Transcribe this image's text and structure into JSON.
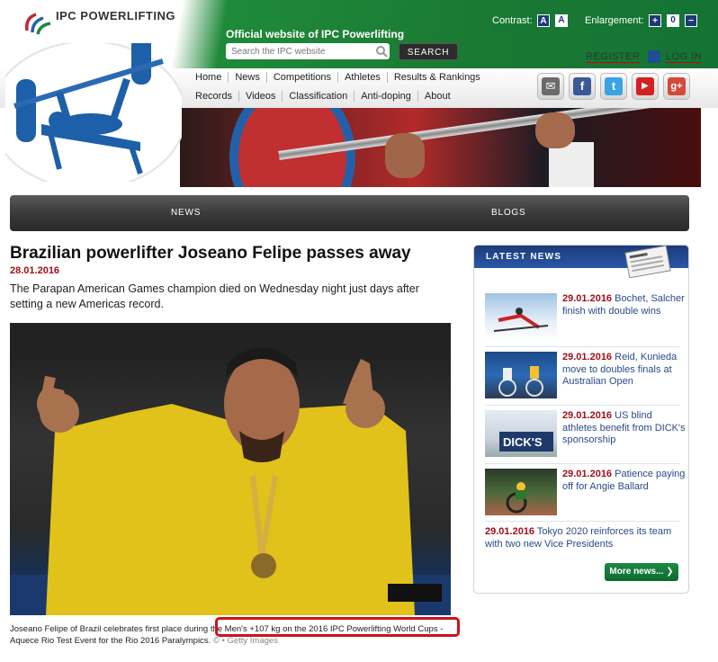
{
  "header": {
    "brand": "IPC POWERLIFTING",
    "site_title": "Official website of IPC Powerlifting",
    "search_placeholder": "Search the IPC website",
    "search_button": "SEARCH",
    "contrast_label": "Contrast:",
    "contrast_options": [
      "A",
      "A"
    ],
    "enlargement_label": "Enlargement:",
    "enlargement_controls": [
      "+",
      "0",
      "−"
    ],
    "register": "REGISTER",
    "login": "LOG IN"
  },
  "nav": {
    "row1": [
      "Home",
      "News",
      "Competitions",
      "Athletes",
      "Results & Rankings"
    ],
    "row2": [
      "Records",
      "Videos",
      "Classification",
      "Anti-doping",
      "About"
    ]
  },
  "social": [
    {
      "name": "email",
      "glyph": "✉",
      "color": "#6b6b6b"
    },
    {
      "name": "facebook",
      "glyph": "f",
      "color": "#3b5998"
    },
    {
      "name": "twitter",
      "glyph": "t",
      "color": "#3aa3e3"
    },
    {
      "name": "youtube",
      "glyph": "▶",
      "color": "#d42020"
    },
    {
      "name": "google-plus",
      "glyph": "g+",
      "color": "#d44a3a"
    }
  ],
  "tabs": [
    "NEWS",
    "BLOGS"
  ],
  "article": {
    "title": "Brazilian powerlifter Joseano Felipe passes away",
    "date": "28.01.2016",
    "lead": "The Parapan American Games champion died on Wednesday night just days after setting a new Americas record.",
    "caption": "Joseano Felipe of Brazil celebrates first place during the Men's +107 kg on the 2016 IPC Powerlifting World Cups - Aquece Rio Test Event for the Rio 2016 Paralympics.",
    "credit": "© • Getty Images"
  },
  "latest_news": {
    "heading": "LATEST NEWS",
    "items": [
      {
        "date": "29.01.2016",
        "text": "Bochet, Salcher finish with double wins"
      },
      {
        "date": "29.01.2016",
        "text": "Reid, Kunieda move to doubles finals at Australian Open"
      },
      {
        "date": "29.01.2016",
        "text": "US blind athletes benefit from DICK's sponsorship"
      },
      {
        "date": "29.01.2016",
        "text": "Patience paying off for Angie Ballard"
      },
      {
        "date": "29.01.2016",
        "text": "Tokyo 2020 reinforces its team with two new Vice Presidents"
      }
    ],
    "more": "More news..."
  },
  "colors": {
    "green": "#1a7a33",
    "accent_red": "#a10f1a",
    "link_blue": "#2a4a8a"
  }
}
